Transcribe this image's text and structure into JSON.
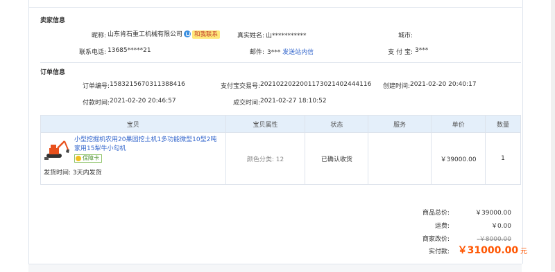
{
  "seller": {
    "title": "卖家信息",
    "nickname_label": "昵称:",
    "nickname": "山东肯石重工机械有限公司",
    "chat_label": "和我联系",
    "realname_label": "真实姓名:",
    "realname": "山***********",
    "city_label": "城市:",
    "city": "",
    "phone_label": "联系电话:",
    "phone": "13685*****21",
    "email_label": "邮件:",
    "email": "3***",
    "send_msg_label": "发送站内信",
    "alipay_label": "支 付 宝:",
    "alipay": "3***"
  },
  "order": {
    "title": "订单信息",
    "order_no_label": "订单编号:",
    "order_no": "1583215670311388416",
    "alipay_no_label": "支付宝交易号:",
    "alipay_no": "2021022022001173021402444116",
    "created_label": "创建时间:",
    "created": "2021-02-20 20:40:17",
    "paid_label": "付款时间:",
    "paid": "2021-02-20 20:46:57",
    "done_label": "成交时间:",
    "done": "2021-02-27 18:10:52"
  },
  "table": {
    "headers": [
      "宝贝",
      "宝贝属性",
      "状态",
      "服务",
      "单价",
      "数量"
    ],
    "item": {
      "title": "小型挖掘机农用20果园挖土机1多功能微型10型2吨家用15犁牛小勾机",
      "badge": "保障卡",
      "ship_label": "发货时间:",
      "ship_value": "3天内发货",
      "attr": "颜色分类: 12",
      "status": "已确认收货",
      "service": "",
      "price": "￥39000.00",
      "qty": "1"
    }
  },
  "summary": {
    "goods_total_label": "商品总价:",
    "goods_total": "￥39000.00",
    "freight_label": "运费:",
    "freight": "￥0.00",
    "adjust_label": "商家改价:",
    "adjust": "-￥8000.00",
    "paid_label": "实付款:",
    "paid": "￥31000.00",
    "paid_unit": "元"
  }
}
